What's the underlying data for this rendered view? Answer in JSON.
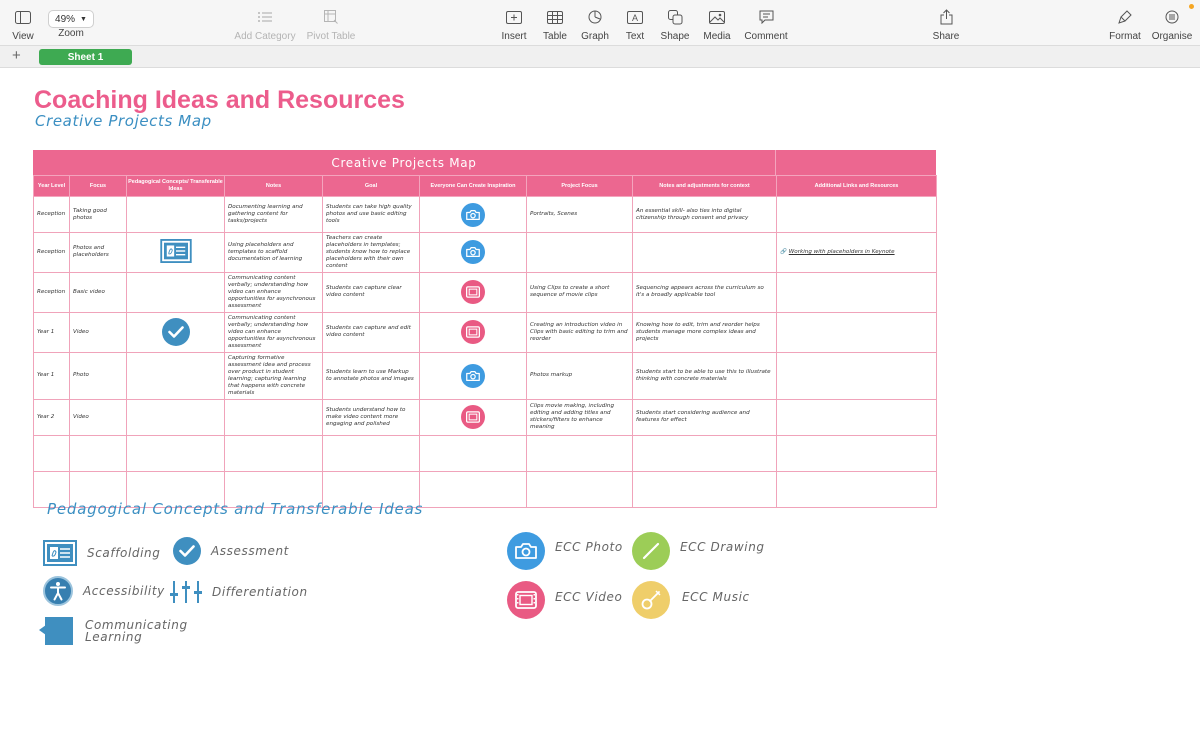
{
  "toolbar": {
    "view": "View",
    "zoom_label": "Zoom",
    "zoom_value": "49%",
    "add_category": "Add Category",
    "pivot_table": "Pivot Table",
    "insert": "Insert",
    "table": "Table",
    "graph": "Graph",
    "text": "Text",
    "shape": "Shape",
    "media": "Media",
    "comment": "Comment",
    "share": "Share",
    "format": "Format",
    "organise": "Organise"
  },
  "sheetbar": {
    "add": "+",
    "active_tab": "Sheet 1"
  },
  "document": {
    "title": "Coaching Ideas and Resources",
    "subtitle": "Creative Projects Map"
  },
  "table": {
    "title": "Creative Projects Map",
    "headers": [
      "Year Level",
      "Focus",
      "Pedagogical Concepts/ Transferable Ideas",
      "Notes",
      "Goal",
      "Everyone Can Create Inspiration",
      "Project Focus",
      "Notes and adjustments for context",
      "Additional Links and Resources"
    ],
    "rows": [
      {
        "year": "Reception",
        "focus": "Taking good photos",
        "concept": "",
        "notes": "Documenting learning and gathering content for tasks/projects",
        "goal": "Students can take high quality photos and use basic editing tools",
        "inspiration": "photo",
        "project_focus": "Portraits, Scenes",
        "adjustments": "An essential skill- also ties into digital citizenship through consent and privacy",
        "links": ""
      },
      {
        "year": "Reception",
        "focus": "Photos and placeholders",
        "concept": "scaffolding",
        "notes": "Using placeholders and templates to scaffold documentation of learning",
        "goal": "Teachers can create placeholders in templates; students know how to replace placeholders with their own content",
        "inspiration": "photo",
        "project_focus": "",
        "adjustments": "",
        "links": "Working with placeholders in Keynote"
      },
      {
        "year": "Reception",
        "focus": "Basic video",
        "concept": "",
        "notes": "Communicating content verbally; understanding how video can enhance opportunities for asynchronous assessment",
        "goal": "Students can capture clear video content",
        "inspiration": "video",
        "project_focus": "Using Clips to create a short sequence of movie clips",
        "adjustments": "Sequencing appears across the curriculum so it's a broadly applicable tool",
        "links": ""
      },
      {
        "year": "Year 1",
        "focus": "Video",
        "concept": "assessment",
        "notes": "Communicating content verbally; understanding how video can enhance opportunities for asynchronous assessment",
        "goal": "Students can capture and edit video content",
        "inspiration": "video",
        "project_focus": "Creating an introduction video in Clips with basic editing to trim and reorder",
        "adjustments": "Knowing how to edit, trim and reorder helps students manage more complex ideas and projects",
        "links": ""
      },
      {
        "year": "Year 1",
        "focus": "Photo",
        "concept": "",
        "notes": "Capturing formative assessment idea and process over product in student learning; capturing learning that happens with concrete materials",
        "goal": "Students learn to use Markup to annotate photos and images",
        "inspiration": "photo",
        "project_focus": "Photos markup",
        "adjustments": "Students start to be able to use this to illustrate thinking with concrete materials",
        "links": ""
      },
      {
        "year": "Year 2",
        "focus": "Video",
        "concept": "",
        "notes": "",
        "goal": "Students understand how to make video content more engaging and polished",
        "inspiration": "video",
        "project_focus": "Clips movie making, including editing and adding titles and stickers/filters to enhance meaning",
        "adjustments": "Students start considering audience and features for effect",
        "links": ""
      },
      {
        "year": "",
        "focus": "",
        "concept": "",
        "notes": "",
        "goal": "",
        "inspiration": "",
        "project_focus": "",
        "adjustments": "",
        "links": ""
      },
      {
        "year": "",
        "focus": "",
        "concept": "",
        "notes": "",
        "goal": "",
        "inspiration": "",
        "project_focus": "",
        "adjustments": "",
        "links": ""
      }
    ]
  },
  "legend": {
    "title": "Pedagogical Concepts and Transferable Ideas",
    "scaffolding": "Scaffolding",
    "assessment": "Assessment",
    "accessibility": "Accessibility",
    "differentiation": "Differentiation",
    "communicating": "Communicating Learning",
    "ecc_photo": "ECC Photo",
    "ecc_drawing": "ECC Drawing",
    "ecc_video": "ECC Video",
    "ecc_music": "ECC Music"
  },
  "colors": {
    "title_pink": "#ec5c8c",
    "header_pink": "#ec6790",
    "accent_blue": "#3b8fc2",
    "sheet_green": "#3eaa52",
    "ecc_photo": "#3e9be0",
    "ecc_video": "#e95a83",
    "ecc_drawing": "#9ccd57",
    "ecc_music": "#efce6a"
  }
}
